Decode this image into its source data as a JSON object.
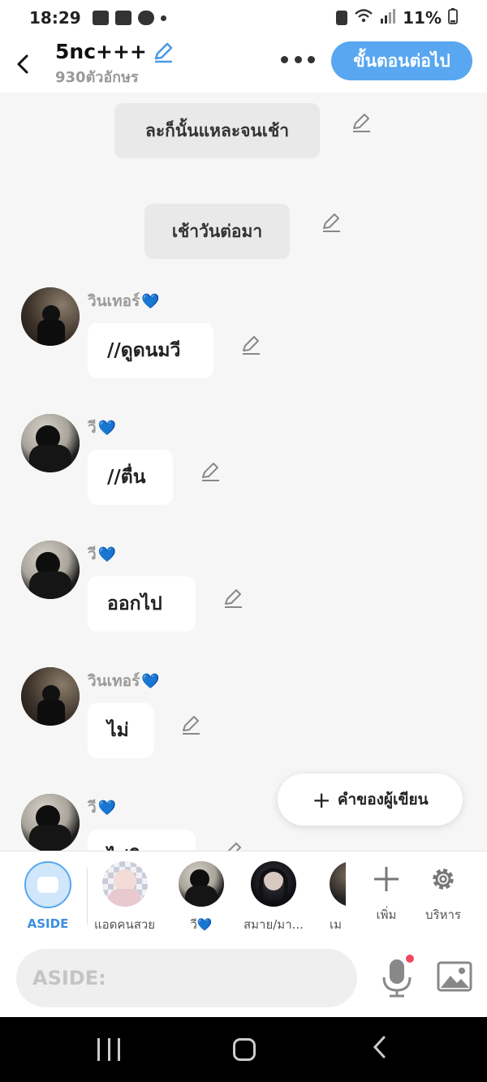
{
  "status": {
    "time": "18:29",
    "battery": "11%"
  },
  "header": {
    "title": "5nc+++",
    "subtitle": "930ตัวอักษร",
    "next_label": "ขั้นตอนต่อไป"
  },
  "narrations": [
    {
      "text": "ละก็นั้นแหละจนเช้า"
    },
    {
      "text": "เช้าวันต่อมา"
    }
  ],
  "messages": [
    {
      "sender": "วินเทอร์",
      "text": "//ดูดนมวี"
    },
    {
      "sender": "วี",
      "text": "//ตื่น"
    },
    {
      "sender": "วี",
      "text": "ออกไป"
    },
    {
      "sender": "วินเทอร์",
      "text": "ไม่"
    },
    {
      "sender": "วี",
      "text": "ไปดิ"
    }
  ],
  "heart_glyph": "💙",
  "fab": {
    "label": "คำของผู้เขียน"
  },
  "characters": [
    {
      "label": "ASIDE"
    },
    {
      "label": "แอดคนสวย"
    },
    {
      "label": "วี💙"
    },
    {
      "label": "สมาย/มา..."
    },
    {
      "label": "เม"
    }
  ],
  "tools": {
    "add_label": "เพิ่ม",
    "manage_label": "บริหาร"
  },
  "input": {
    "placeholder": "ASIDE:"
  },
  "colors": {
    "accent": "#58a7f0",
    "heart": "#2f9ae8",
    "mic_dot": "#f04860"
  }
}
